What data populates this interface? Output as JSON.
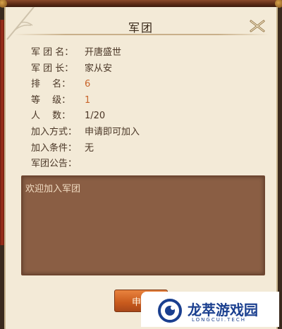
{
  "window": {
    "title": "军团",
    "close_icon": "crossed-scrolls-close-icon"
  },
  "legion": {
    "fields": [
      {
        "label": "军 团 名：",
        "value": "开唐盛世",
        "numeric": false
      },
      {
        "label": "军 团 长：",
        "value": "家从安",
        "numeric": false
      },
      {
        "label": "排　 名：",
        "value": "6",
        "numeric": true
      },
      {
        "label": "等　 级：",
        "value": "1",
        "numeric": true
      },
      {
        "label": "人　 数：",
        "value": "1/20",
        "numeric": false
      },
      {
        "label": "加入方式：",
        "value": "申请即可加入",
        "numeric": false
      },
      {
        "label": "加入条件：",
        "value": "无",
        "numeric": false
      },
      {
        "label": "军团公告：",
        "value": "",
        "numeric": false
      }
    ],
    "announcement": "欢迎加入军团"
  },
  "actions": {
    "apply_label": "申"
  },
  "watermark": {
    "name": "龙萃游戏园",
    "sub": "LONGCUI.TECH",
    "logo_icon": "blue-circle-logo-icon"
  },
  "colors": {
    "panel_bg": "#f3ead7",
    "notice_bg": "#8a5e44",
    "numeric_value": "#c8642a",
    "button_orange": "#d8682a",
    "watermark_blue": "#1a3f8f"
  }
}
